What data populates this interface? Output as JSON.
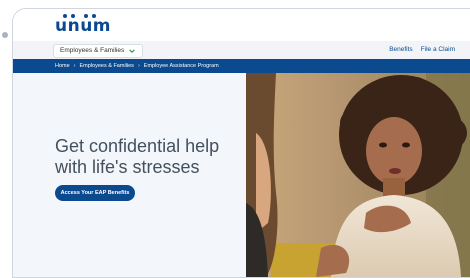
{
  "brand": {
    "logo_text": "unum",
    "color": "#0b4a8f"
  },
  "nav": {
    "dropdown_label": "Employees & Families",
    "dropdown_icon": "chevron-down-icon",
    "links": [
      "Benefits",
      "File a Claim"
    ]
  },
  "breadcrumb": {
    "items": [
      "Home",
      "Employees & Families",
      "Employee Assistance Program"
    ],
    "separator": "›"
  },
  "hero": {
    "title": "Get confidential help with life's stresses",
    "cta_label": "Access Your EAP Benefits",
    "image": "woman-speaking-photo"
  },
  "colors": {
    "primary": "#0b4a8f",
    "hero_bg": "#f3f6fa",
    "title": "#43505e"
  }
}
